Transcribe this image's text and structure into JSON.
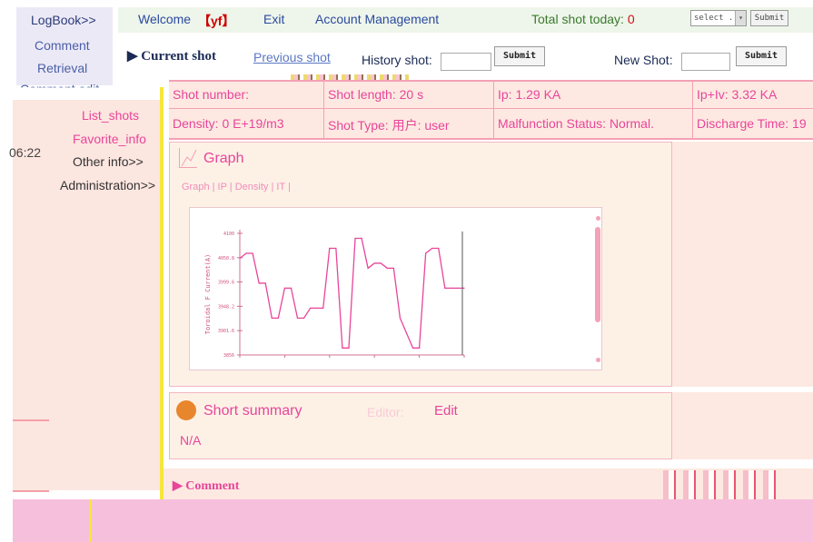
{
  "header": {
    "logbook_label": "LogBook>>",
    "welcome_label": "Welcome",
    "user": "【yf】",
    "exit_label": "Exit",
    "account_label": "Account Management",
    "total_shot_label": "Total shot today:",
    "total_shot_count": "0",
    "select_placeholder": "select ...",
    "select_submit": "Submit"
  },
  "sidebar": {
    "top_links": [
      "Comment",
      "Retrieval",
      "Comment edit"
    ],
    "time": "06:22",
    "menu": [
      "List_shots",
      "Favorite_info",
      "Other info>>",
      "Administration>>"
    ]
  },
  "shot_bar": {
    "current_label": "Current shot",
    "previous_label": "Previous shot",
    "history_label": "History shot:",
    "history_submit": "Submit",
    "new_shot_label": "New Shot:",
    "new_shot_submit": "Submit"
  },
  "info": {
    "shot_number": "Shot number:",
    "shot_length": "Shot length: 20 s",
    "ip": "Ip: 1.29 KA",
    "ip_iv": "Ip+Iv: 3.32 KA",
    "density": "Density: 0 E+19/m3",
    "shot_type": "Shot Type: 用户: user",
    "malfunction": "Malfunction Status: Normal.",
    "discharge": "Discharge Time: 19"
  },
  "graph": {
    "title": "Graph",
    "tabs": "Graph | IP | Density | IT |"
  },
  "summary": {
    "title": "Short summary",
    "editor_label": "Editor:",
    "edit_label": "Edit",
    "content": "N/A"
  },
  "comment": {
    "label": "Comment"
  },
  "colors": {
    "accent_pink": "#e8459a",
    "header_blue": "#2b4aa0",
    "panel_bg": "#fdf1e6"
  },
  "chart_data": {
    "type": "line",
    "ylabel": "Toroidal F Current(A)",
    "ytick_labels": [
      "4100",
      "4050.8",
      "3999.6",
      "3948.2",
      "3901.6",
      "3856"
    ],
    "ylim": [
      3856,
      4100
    ],
    "x": [
      0,
      1,
      2,
      3,
      4,
      5,
      6,
      7,
      8,
      9,
      10,
      11,
      12,
      13,
      14,
      15,
      16,
      17,
      18,
      19,
      20,
      21,
      22,
      23,
      24,
      25,
      26,
      27,
      28,
      29,
      30,
      31,
      32,
      33,
      34,
      35
    ],
    "values": [
      4050,
      4060,
      4060,
      4000,
      4000,
      3930,
      3930,
      3990,
      3990,
      3930,
      3930,
      3950,
      3950,
      3950,
      4070,
      4070,
      3870,
      3870,
      4090,
      4090,
      4030,
      4040,
      4040,
      4030,
      4030,
      3930,
      3900,
      3870,
      3870,
      4060,
      4070,
      4070,
      3990,
      3990,
      3990,
      3990
    ]
  }
}
